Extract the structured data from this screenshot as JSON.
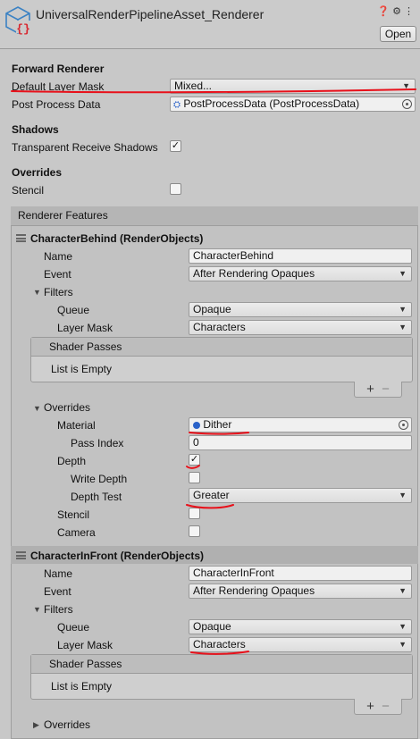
{
  "header": {
    "title": "UniversalRenderPipelineAsset_Renderer",
    "open_label": "Open",
    "icons": [
      "help-icon",
      "settings-icon",
      "more-icon"
    ]
  },
  "forward": {
    "section": "Forward Renderer",
    "layer_mask_label": "Default Layer Mask",
    "layer_mask_value": "Mixed...",
    "ppd_label": "Post Process Data",
    "ppd_value": "PostProcessData (PostProcessData)"
  },
  "shadows": {
    "section": "Shadows",
    "trs_label": "Transparent Receive Shadows",
    "trs_checked": "✓"
  },
  "overrides": {
    "section": "Overrides",
    "stencil_label": "Stencil"
  },
  "features": {
    "header": "Renderer Features",
    "behind": {
      "title": "CharacterBehind (RenderObjects)",
      "name_label": "Name",
      "name_value": "CharacterBehind",
      "event_label": "Event",
      "event_value": "After Rendering Opaques",
      "filters_label": "Filters",
      "queue_label": "Queue",
      "queue_value": "Opaque",
      "layer_label": "Layer Mask",
      "layer_value": "Characters",
      "passes_label": "Shader Passes",
      "passes_empty": "List is Empty",
      "overrides_label": "Overrides",
      "material_label": "Material",
      "material_value": "Dither",
      "pass_index_label": "Pass Index",
      "pass_index_value": "0",
      "depth_label": "Depth",
      "depth_checked": "✓",
      "write_depth_label": "Write Depth",
      "depth_test_label": "Depth Test",
      "depth_test_value": "Greater",
      "stencil_label": "Stencil",
      "camera_label": "Camera"
    },
    "front": {
      "title": "CharacterInFront (RenderObjects)",
      "name_label": "Name",
      "name_value": "CharacterInFront",
      "event_label": "Event",
      "event_value": "After Rendering Opaques",
      "filters_label": "Filters",
      "queue_label": "Queue",
      "queue_value": "Opaque",
      "layer_label": "Layer Mask",
      "layer_value": "Characters",
      "passes_label": "Shader Passes",
      "passes_empty": "List is Empty",
      "overrides_label": "Overrides"
    },
    "plus": "+",
    "minus": "−"
  },
  "colors": {
    "annotation": "#e8101a",
    "material_icon": "#2a62c9"
  }
}
